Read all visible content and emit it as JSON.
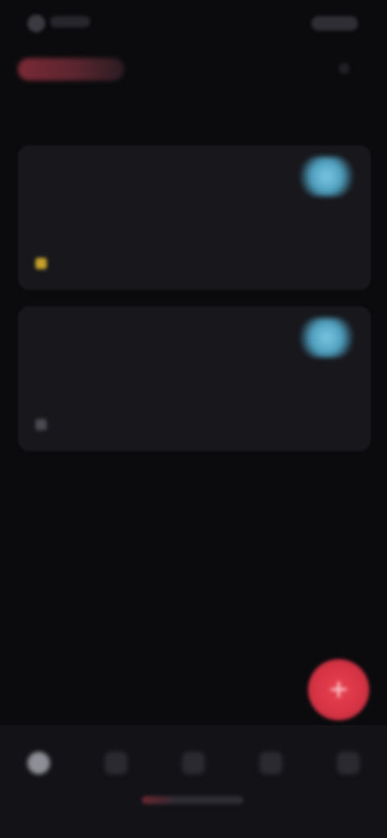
{
  "status_bar": {
    "icons": [
      "status-indicator-icon",
      "battery-icon"
    ]
  },
  "header": {
    "accent_color": "#d63445"
  },
  "alarms": [
    {
      "time": "",
      "subtitle": "",
      "enabled": true,
      "toggle_color": "#79c6e0",
      "sub_icon": "alert-icon",
      "sub_icon_color": "#c9a22b"
    },
    {
      "time": "",
      "subtitle": "",
      "enabled": true,
      "toggle_color": "#79c6e0",
      "sub_icon": "repeat-icon",
      "sub_icon_color": "#4a4a52"
    }
  ],
  "fab": {
    "symbol": "+",
    "icon": "add-icon",
    "color": "#d63445"
  },
  "bottom_nav": {
    "items": [
      {
        "icon": "alarm-icon",
        "active": true
      },
      {
        "icon": "clock-icon",
        "active": false
      },
      {
        "icon": "timer-icon",
        "active": false
      },
      {
        "icon": "stopwatch-icon",
        "active": false
      },
      {
        "icon": "bedtime-icon",
        "active": false
      }
    ]
  }
}
